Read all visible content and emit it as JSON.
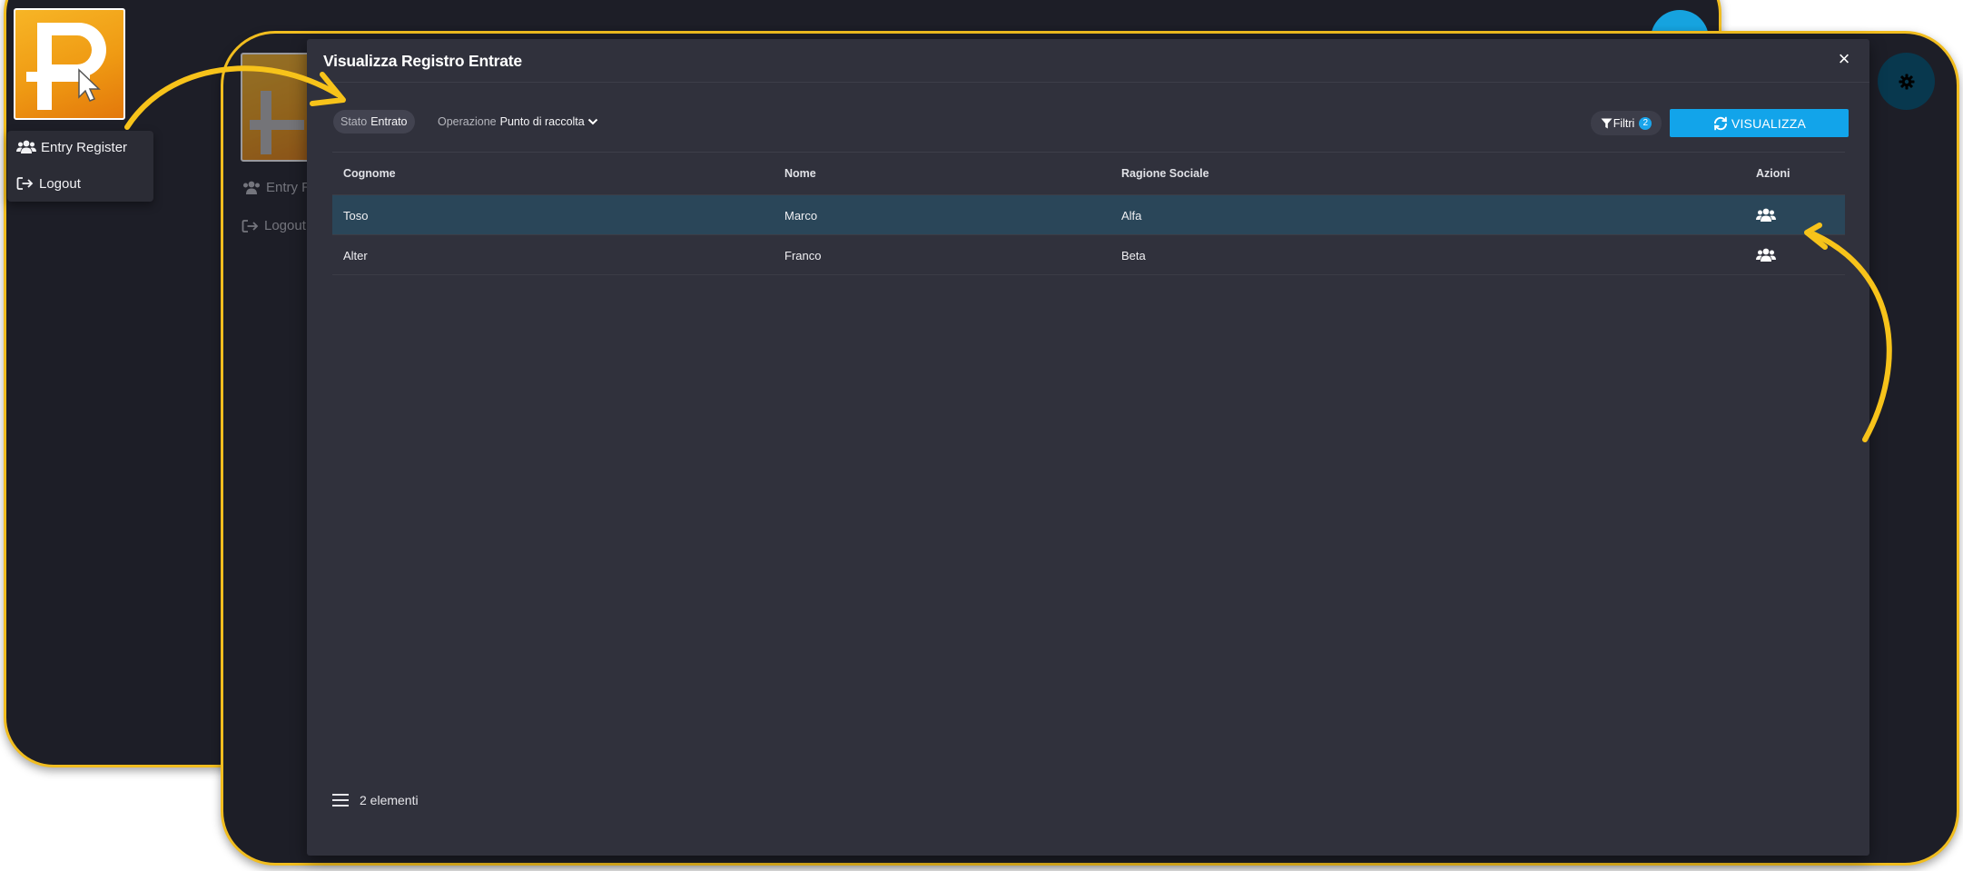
{
  "background_app": {
    "menu": {
      "items": [
        {
          "label": "Entry Register",
          "icon": "users-icon"
        },
        {
          "label": "Logout",
          "icon": "logout-icon"
        }
      ]
    },
    "ghost_menu": {
      "items": [
        {
          "label": "Entry R",
          "icon": "users-icon"
        },
        {
          "label": "Logout",
          "icon": "logout-icon"
        }
      ]
    }
  },
  "modal": {
    "title": "Visualizza Registro Entrate",
    "close_label": "×",
    "filters": {
      "stato": {
        "label": "Stato",
        "value": "Entrato"
      },
      "operazione": {
        "label": "Operazione",
        "value": "Punto di raccolta"
      }
    },
    "filtri_button": {
      "label": "Filtri",
      "badge": "2"
    },
    "visualizza_button": {
      "label": "VISUALIZZA"
    },
    "table": {
      "columns": [
        "Cognome",
        "Nome",
        "Ragione Sociale",
        "Azioni"
      ],
      "rows": [
        {
          "cognome": "Toso",
          "nome": "Marco",
          "ragione_sociale": "Alfa",
          "selected": true
        },
        {
          "cognome": "Alter",
          "nome": "Franco",
          "ragione_sociale": "Beta",
          "selected": false
        }
      ]
    },
    "footer": {
      "count_text": "2 elementi"
    }
  },
  "colors": {
    "accent_blue": "#12a4ea",
    "highlight_yellow": "#f1bd1f",
    "logo_orange": "#f2a31a",
    "selected_row": "#2a4659"
  }
}
